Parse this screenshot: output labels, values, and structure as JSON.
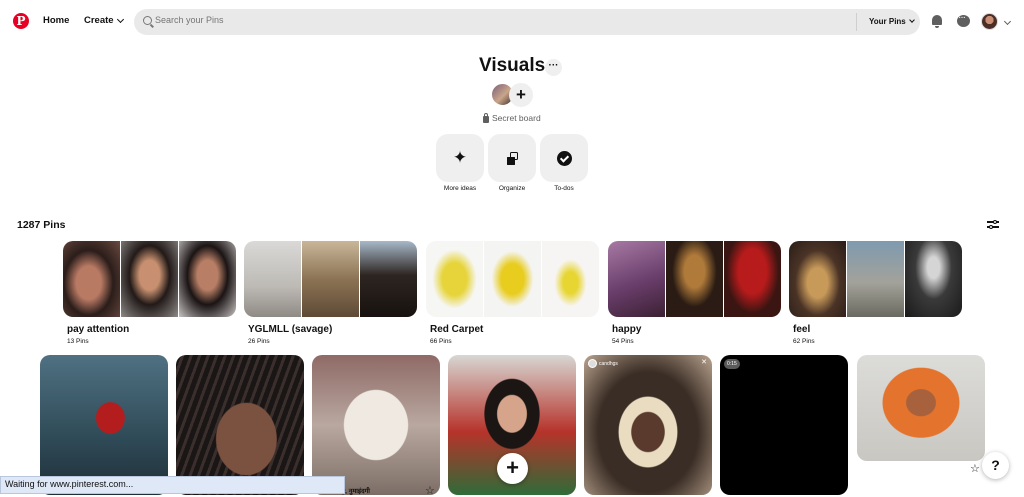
{
  "header": {
    "logo_glyph": "P",
    "nav": {
      "home": "Home",
      "create": "Create"
    },
    "search": {
      "placeholder": "Search your Pins",
      "scope": "Your Pins"
    }
  },
  "board": {
    "title": "Visuals",
    "more_label": "···",
    "add_collaborator": "+",
    "privacy": "Secret board",
    "actions": [
      {
        "label": "More ideas",
        "icon": "sparkle-icon",
        "glyph": "✦"
      },
      {
        "label": "Organize",
        "icon": "organize-icon"
      },
      {
        "label": "To-dos",
        "icon": "check-circle-icon"
      }
    ],
    "pin_count": "1287 Pins"
  },
  "sections": [
    {
      "name": "pay attention",
      "count": "13 Pins"
    },
    {
      "name": "YGLMLL (savage)",
      "count": "26 Pins"
    },
    {
      "name": "Red Carpet",
      "count": "66 Pins"
    },
    {
      "name": "happy",
      "count": "54 Pins"
    },
    {
      "name": "feel",
      "count": "62 Pins"
    }
  ],
  "pins": {
    "video_badge": "0:15",
    "story_user": "candhgs",
    "story_close": "✕",
    "caption_partial": "y, नुमाइंदगी"
  },
  "fabs": {
    "add": "+",
    "help": "?"
  },
  "icons": {
    "star": "☆"
  },
  "status_bar": "Waiting for www.pinterest.com...",
  "colors": {
    "brand": "#e60023",
    "search_bg": "#e9e9e9",
    "button_bg": "#efefef"
  }
}
